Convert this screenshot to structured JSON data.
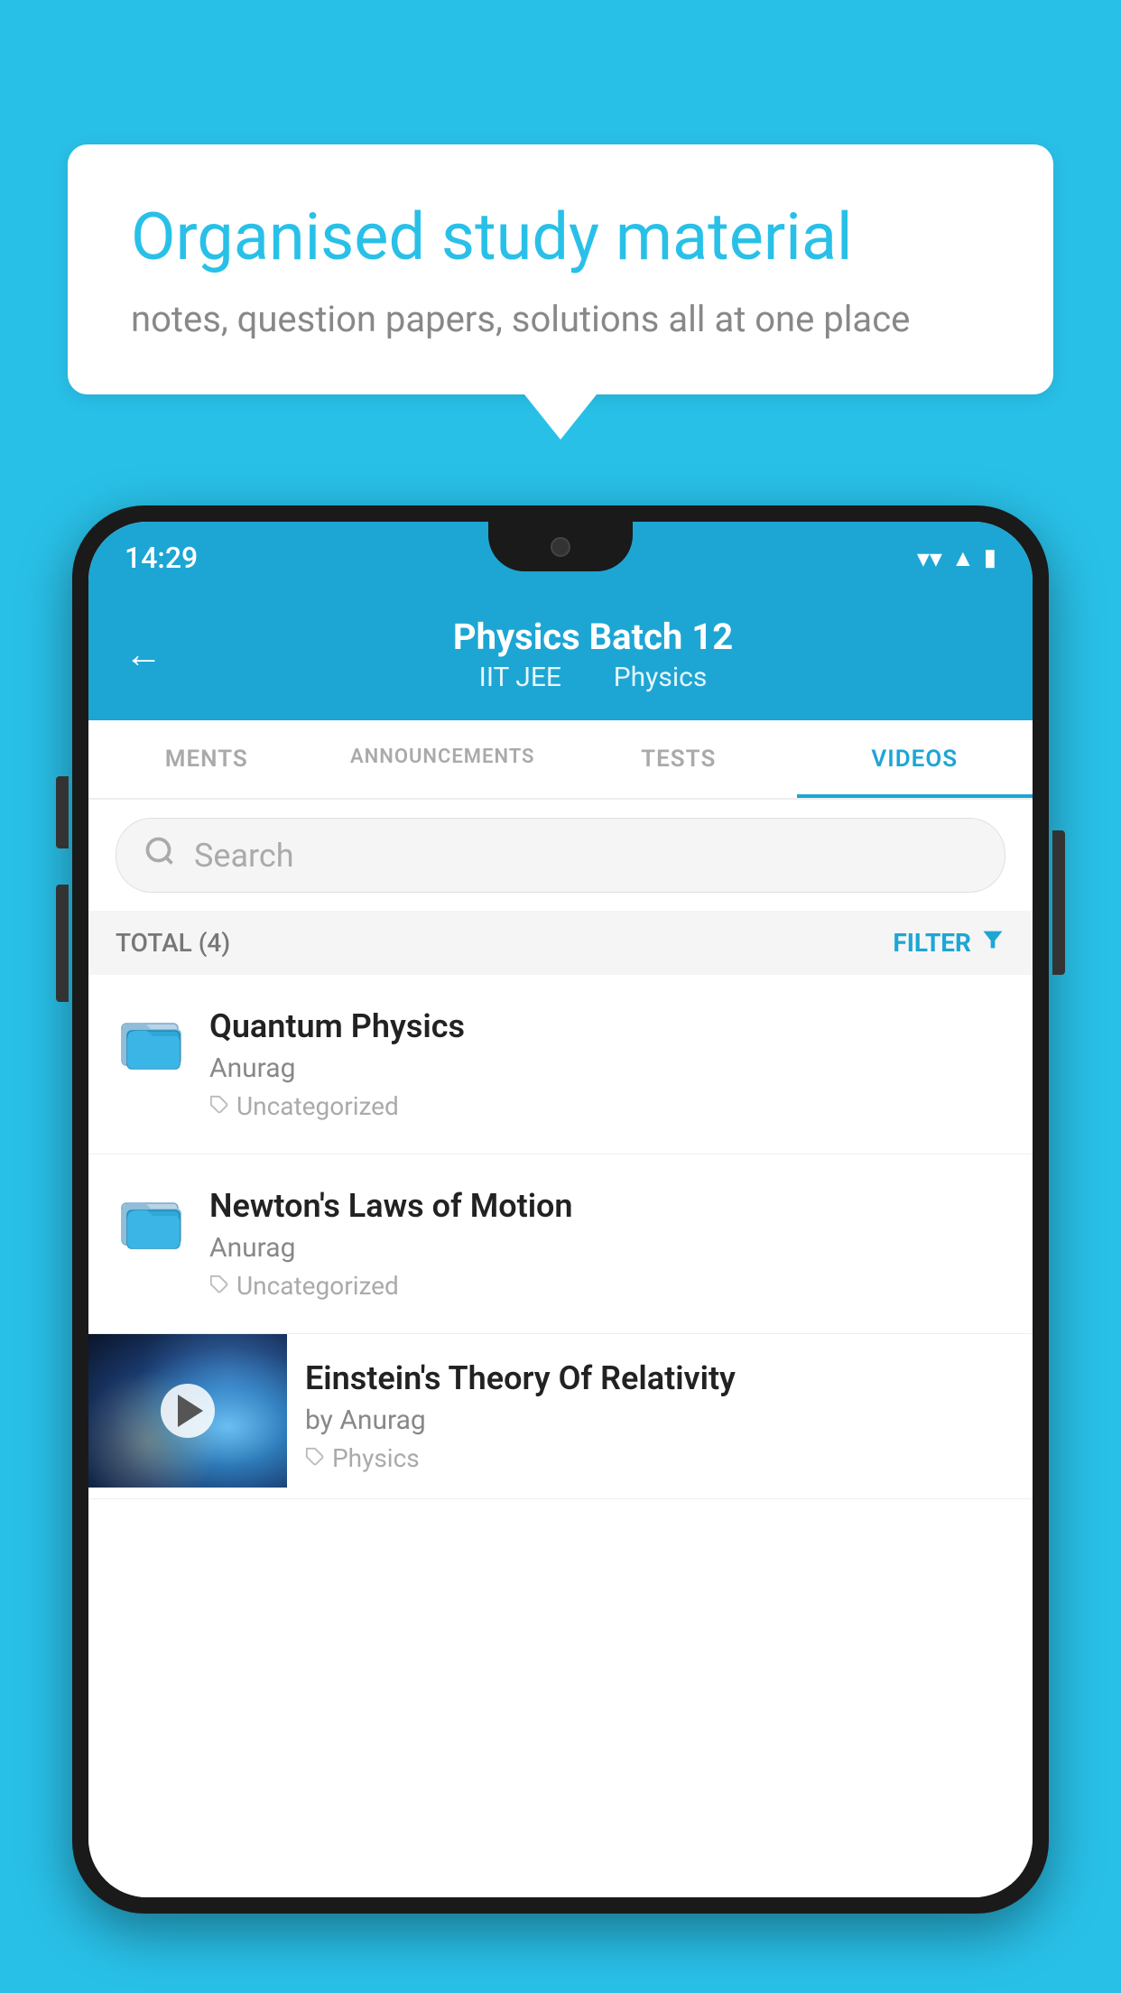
{
  "background_color": "#29C0E8",
  "speech_bubble": {
    "title": "Organised study material",
    "subtitle": "notes, question papers, solutions all at one place"
  },
  "phone": {
    "status_bar": {
      "time": "14:29",
      "icons": [
        "wifi",
        "signal",
        "battery"
      ]
    },
    "header": {
      "back_label": "←",
      "title": "Physics Batch 12",
      "subtitle_left": "IIT JEE",
      "subtitle_right": "Physics"
    },
    "tabs": [
      {
        "label": "MENTS",
        "active": false
      },
      {
        "label": "ANNOUNCEMENTS",
        "active": false
      },
      {
        "label": "TESTS",
        "active": false
      },
      {
        "label": "VIDEOS",
        "active": true
      }
    ],
    "search": {
      "placeholder": "Search"
    },
    "filter_row": {
      "total_label": "TOTAL (4)",
      "filter_label": "FILTER"
    },
    "items": [
      {
        "title": "Quantum Physics",
        "author": "Anurag",
        "tag": "Uncategorized",
        "has_thumb": false
      },
      {
        "title": "Newton's Laws of Motion",
        "author": "Anurag",
        "tag": "Uncategorized",
        "has_thumb": false
      },
      {
        "title": "Einstein's Theory Of Relativity",
        "author": "by Anurag",
        "tag": "Physics",
        "has_thumb": true
      }
    ]
  }
}
